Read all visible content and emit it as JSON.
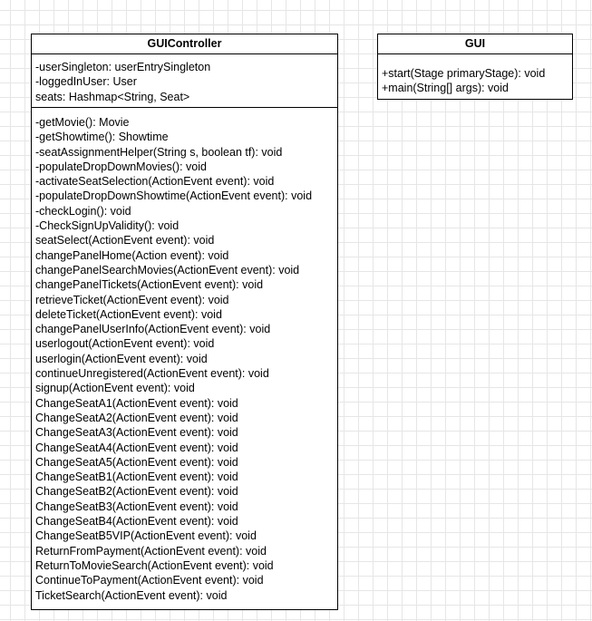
{
  "classes": [
    {
      "name": "GUIController",
      "attributes": [
        "-userSingleton: userEntrySingleton",
        "-loggedInUser: User",
        "seats: Hashmap<String, Seat>"
      ],
      "operations": [
        "-getMovie(): Movie",
        "-getShowtime(): Showtime",
        "-seatAssignmentHelper(String s, boolean tf): void",
        "-populateDropDownMovies(): void",
        "-activateSeatSelection(ActionEvent event): void",
        "-populateDropDownShowtime(ActionEvent event): void",
        "-checkLogin(): void",
        "-CheckSignUpValidity(): void",
        "seatSelect(ActionEvent event): void",
        "changePanelHome(Action event): void",
        "changePanelSearchMovies(ActionEvent event): void",
        "changePanelTickets(ActionEvent event): void",
        "retrieveTicket(ActionEvent event): void",
        "deleteTicket(ActionEvent event): void",
        "changePanelUserInfo(ActionEvent event): void",
        "userlogout(ActionEvent event): void",
        "userlogin(ActionEvent event): void",
        "continueUnregistered(ActionEvent event): void",
        "signup(ActionEvent event): void",
        "ChangeSeatA1(ActionEvent event): void",
        "ChangeSeatA2(ActionEvent event): void",
        "ChangeSeatA3(ActionEvent event): void",
        "ChangeSeatA4(ActionEvent event): void",
        "ChangeSeatA5(ActionEvent event): void",
        "ChangeSeatB1(ActionEvent event): void",
        "ChangeSeatB2(ActionEvent event): void",
        "ChangeSeatB3(ActionEvent event): void",
        "ChangeSeatB4(ActionEvent event): void",
        "ChangeSeatB5VIP(ActionEvent event): void",
        "ReturnFromPayment(ActionEvent event): void",
        "ReturnToMovieSearch(ActionEvent event): void",
        "ContinueToPayment(ActionEvent event): void",
        "TicketSearch(ActionEvent event): void"
      ]
    },
    {
      "name": "GUI",
      "attributes": [],
      "operations": [
        "+start(Stage primaryStage): void",
        "+main(String[] args): void"
      ]
    }
  ]
}
